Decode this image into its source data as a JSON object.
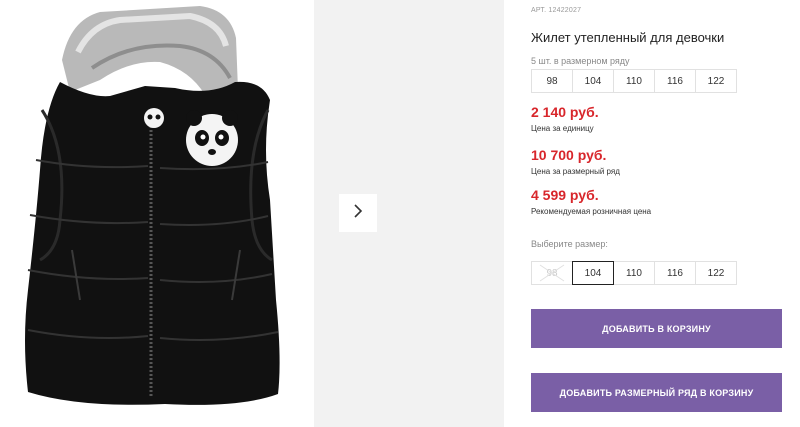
{
  "product": {
    "article": "АРТ. 12422027",
    "title": "Жилет утепленный для девочки",
    "pack_label": "5 шт. в размерном ряду",
    "pack_sizes": [
      "98",
      "104",
      "110",
      "116",
      "122"
    ],
    "prices": [
      {
        "value": "2 140 руб.",
        "note": "Цена за единицу"
      },
      {
        "value": "10 700 руб.",
        "note": "Цена за размерный ряд"
      },
      {
        "value": "4 599 руб.",
        "note": "Рекомендуемая розничная цена"
      }
    ],
    "choose_label": "Выберите размер:",
    "size_options": [
      {
        "label": "98",
        "state": "disabled"
      },
      {
        "label": "104",
        "state": "selected"
      },
      {
        "label": "110",
        "state": "available"
      },
      {
        "label": "116",
        "state": "available"
      },
      {
        "label": "122",
        "state": "available"
      }
    ]
  },
  "buttons": {
    "add_to_cart": "ДОБАВИТЬ В КОРЗИНУ",
    "add_range_to_cart": "ДОБАВИТЬ РАЗМЕРНЫЙ РЯД В КОРЗИНУ"
  },
  "colors": {
    "accent": "#7a5fa6",
    "price": "#d8262b",
    "thumb_bg": "#f2f2f2"
  },
  "icons": {
    "next": "chevron-right-icon",
    "disabled_size": "cross-out-icon"
  }
}
